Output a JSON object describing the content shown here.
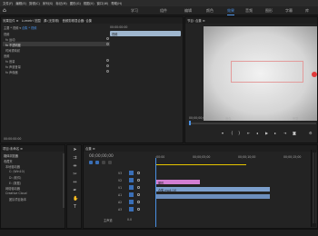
{
  "menubar": [
    "文件(F)",
    "编辑(E)",
    "剪辑(C)",
    "序列(S)",
    "标记(M)",
    "图形(G)",
    "视图(V)",
    "窗口(W)",
    "帮助(H)"
  ],
  "workspaces": {
    "tabs": [
      "学习",
      "组件",
      "编辑",
      "颜色",
      "效果",
      "音频",
      "图形",
      "字幕",
      "库"
    ],
    "active_index": 4
  },
  "effect_controls": {
    "tabs": [
      "效果控件 ≡",
      "Lumetri 范围",
      "源:(无剪辑)",
      "音频剪辑混合器: 合集"
    ],
    "breadcrumb": "主要 * 视频 ▾",
    "breadcrumb2": "合集 * 视频",
    "timecode": "00:00:00:00",
    "clip_label": "视频",
    "rows": [
      "视频",
      "fx 运动",
      "fx 不透明度",
      "时间重映射",
      "音频",
      "fx 音量",
      "fx 声道音量",
      "fx 声像器"
    ]
  },
  "program_monitor": {
    "title": "节目: 合集 ≡",
    "timecode": "00;00;00;00",
    "fit": "适合",
    "full": "完整"
  },
  "project": {
    "tabs": [
      "项目:未命名 ≡",
      "媒体浏览器"
    ],
    "tree": [
      "收藏夹",
      "本地驱动器",
      "C: (Win10)",
      "D: (软件)",
      "E: (数据)",
      "网络驱动器",
      "Creative Cloud",
      "团队项目版本"
    ]
  },
  "timeline": {
    "title": "合集 ≡",
    "timecode": "00;00;00;00",
    "ruler": [
      ":00:00",
      "00;00;05;00",
      "00;00;10;00",
      "00;00;15;00"
    ],
    "tracks": [
      "V3",
      "V2",
      "V1",
      "A1",
      "A2",
      "A3"
    ],
    "clip_pink": "图形",
    "clip_blue": "合集 mp4 [V]",
    "master": "主声道",
    "master_value": "0.0"
  },
  "colors": {
    "accent": "#4a90e2",
    "clip_pink": "#d27ed2",
    "clip_blue": "#7c9fcc",
    "playhead": "#e5c400"
  }
}
